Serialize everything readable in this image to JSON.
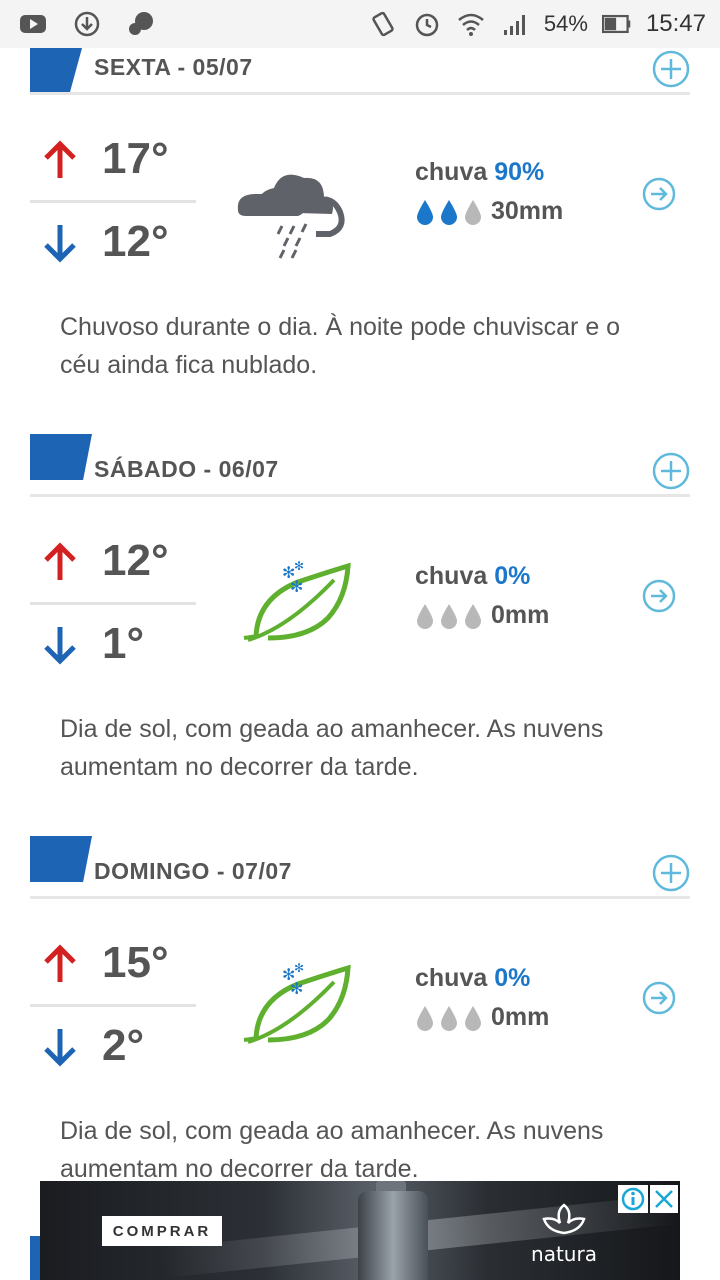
{
  "status_bar": {
    "battery": "54%",
    "time": "15:47"
  },
  "days": [
    {
      "title": "SEXTA - 05/07",
      "max": "17°",
      "min": "12°",
      "rain_label": "chuva",
      "rain_pct": "90%",
      "rain_mm": "30mm",
      "drops_filled": 2,
      "icon": "rain-cloud-icon",
      "description": "Chuvoso durante o dia. À noite pode chuviscar e o céu ainda fica nublado."
    },
    {
      "title": "SÁBADO - 06/07",
      "max": "12°",
      "min": "1°",
      "rain_label": "chuva",
      "rain_pct": "0%",
      "rain_mm": "0mm",
      "drops_filled": 0,
      "icon": "frost-leaf-icon",
      "description": "Dia de sol, com geada ao amanhecer. As nuvens aumentam no decorrer da tarde."
    },
    {
      "title": "DOMINGO - 07/07",
      "max": "15°",
      "min": "2°",
      "rain_label": "chuva",
      "rain_pct": "0%",
      "rain_mm": "0mm",
      "drops_filled": 0,
      "icon": "frost-leaf-icon",
      "description": "Dia de sol, com geada ao amanhecer. As nuvens aumentam no decorrer da tarde."
    }
  ],
  "ad": {
    "button_label": "COMPRAR",
    "brand": "natura"
  },
  "colors": {
    "accent_blue": "#1e64b4",
    "rain_blue": "#1b77c9",
    "up_red": "#d32020",
    "down_blue": "#1e64b4",
    "link_cyan": "#5fb9dc",
    "leaf_green": "#5fb02e"
  }
}
